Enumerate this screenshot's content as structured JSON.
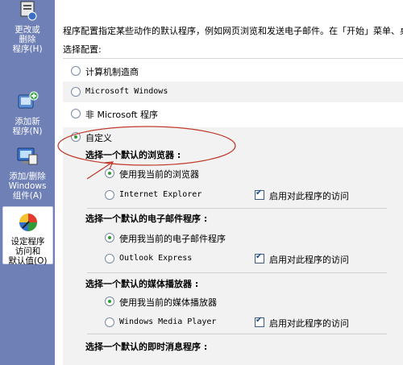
{
  "sidebar": {
    "items": [
      {
        "label": "更改或\n删除\n程序(H)"
      },
      {
        "label": "添加新\n程序(N)"
      },
      {
        "label": "添加/删除\nWindows\n组件(A)"
      },
      {
        "label": "设定程序\n访问和\n默认值(O)"
      }
    ]
  },
  "content": {
    "intro": "程序配置指定某些动作的默认程序，例如网页浏览和发送电子邮件。在「开始」菜单、桌",
    "choose_label": "选择配置:",
    "options": [
      {
        "label": "计算机制造商"
      },
      {
        "label": "Microsoft Windows"
      },
      {
        "label": "非 Microsoft 程序"
      },
      {
        "label": "自定义"
      }
    ],
    "sections": [
      {
        "title": "选择一个默认的浏览器 :",
        "current": "使用我当前的浏览器",
        "alt": "Internet Explorer",
        "access": "启用对此程序的访问"
      },
      {
        "title": "选择一个默认的电子邮件程序 :",
        "current": "使用我当前的电子邮件程序",
        "alt": "Outlook Express",
        "access": "启用对此程序的访问"
      },
      {
        "title": "选择一个默认的媒体播放器 :",
        "current": "使用我当前的媒体播放器",
        "alt": "Windows Media Player",
        "access": "启用对此程序的访问"
      },
      {
        "title": "选择一个默认的即时消息程序 :"
      }
    ]
  },
  "colors": {
    "sidebar": "#6f80b6",
    "annotation": "#c0392b",
    "radio_dot": "#2f9a38"
  }
}
